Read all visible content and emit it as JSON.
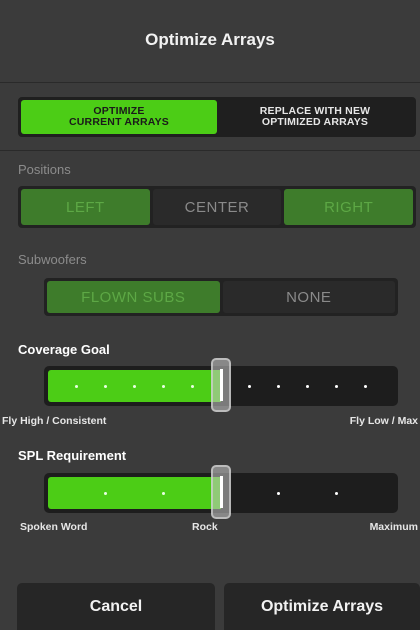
{
  "dialog": {
    "title": "Optimize Arrays",
    "mode": {
      "options": [
        "OPTIMIZE\nCURRENT ARRAYS",
        "REPLACE WITH NEW\nOPTIMIZED ARRAYS"
      ],
      "selected": 0
    },
    "positions": {
      "label": "Positions",
      "options": [
        "LEFT",
        "CENTER",
        "RIGHT"
      ],
      "selected": [
        0,
        2
      ]
    },
    "subwoofers": {
      "label": "Subwoofers",
      "options": [
        "FLOWN SUBS",
        "NONE"
      ],
      "selected": 0
    },
    "coverage_goal": {
      "label": "Coverage Goal",
      "min_label": "Fly High / Consistent",
      "max_label": "Fly Low / Max",
      "value": 0.5,
      "steps": 12
    },
    "spl_requirement": {
      "label": "SPL Requirement",
      "min_label": "Spoken Word",
      "mid_label": "Rock",
      "max_label": "Maximum",
      "value": 0.5,
      "steps": 6
    },
    "buttons": {
      "cancel": "Cancel",
      "optimize": "Optimize Arrays"
    }
  },
  "colors": {
    "accent": "#4ccd16",
    "dim_accent": "#3e7c2b",
    "background": "#3b3b3b"
  }
}
